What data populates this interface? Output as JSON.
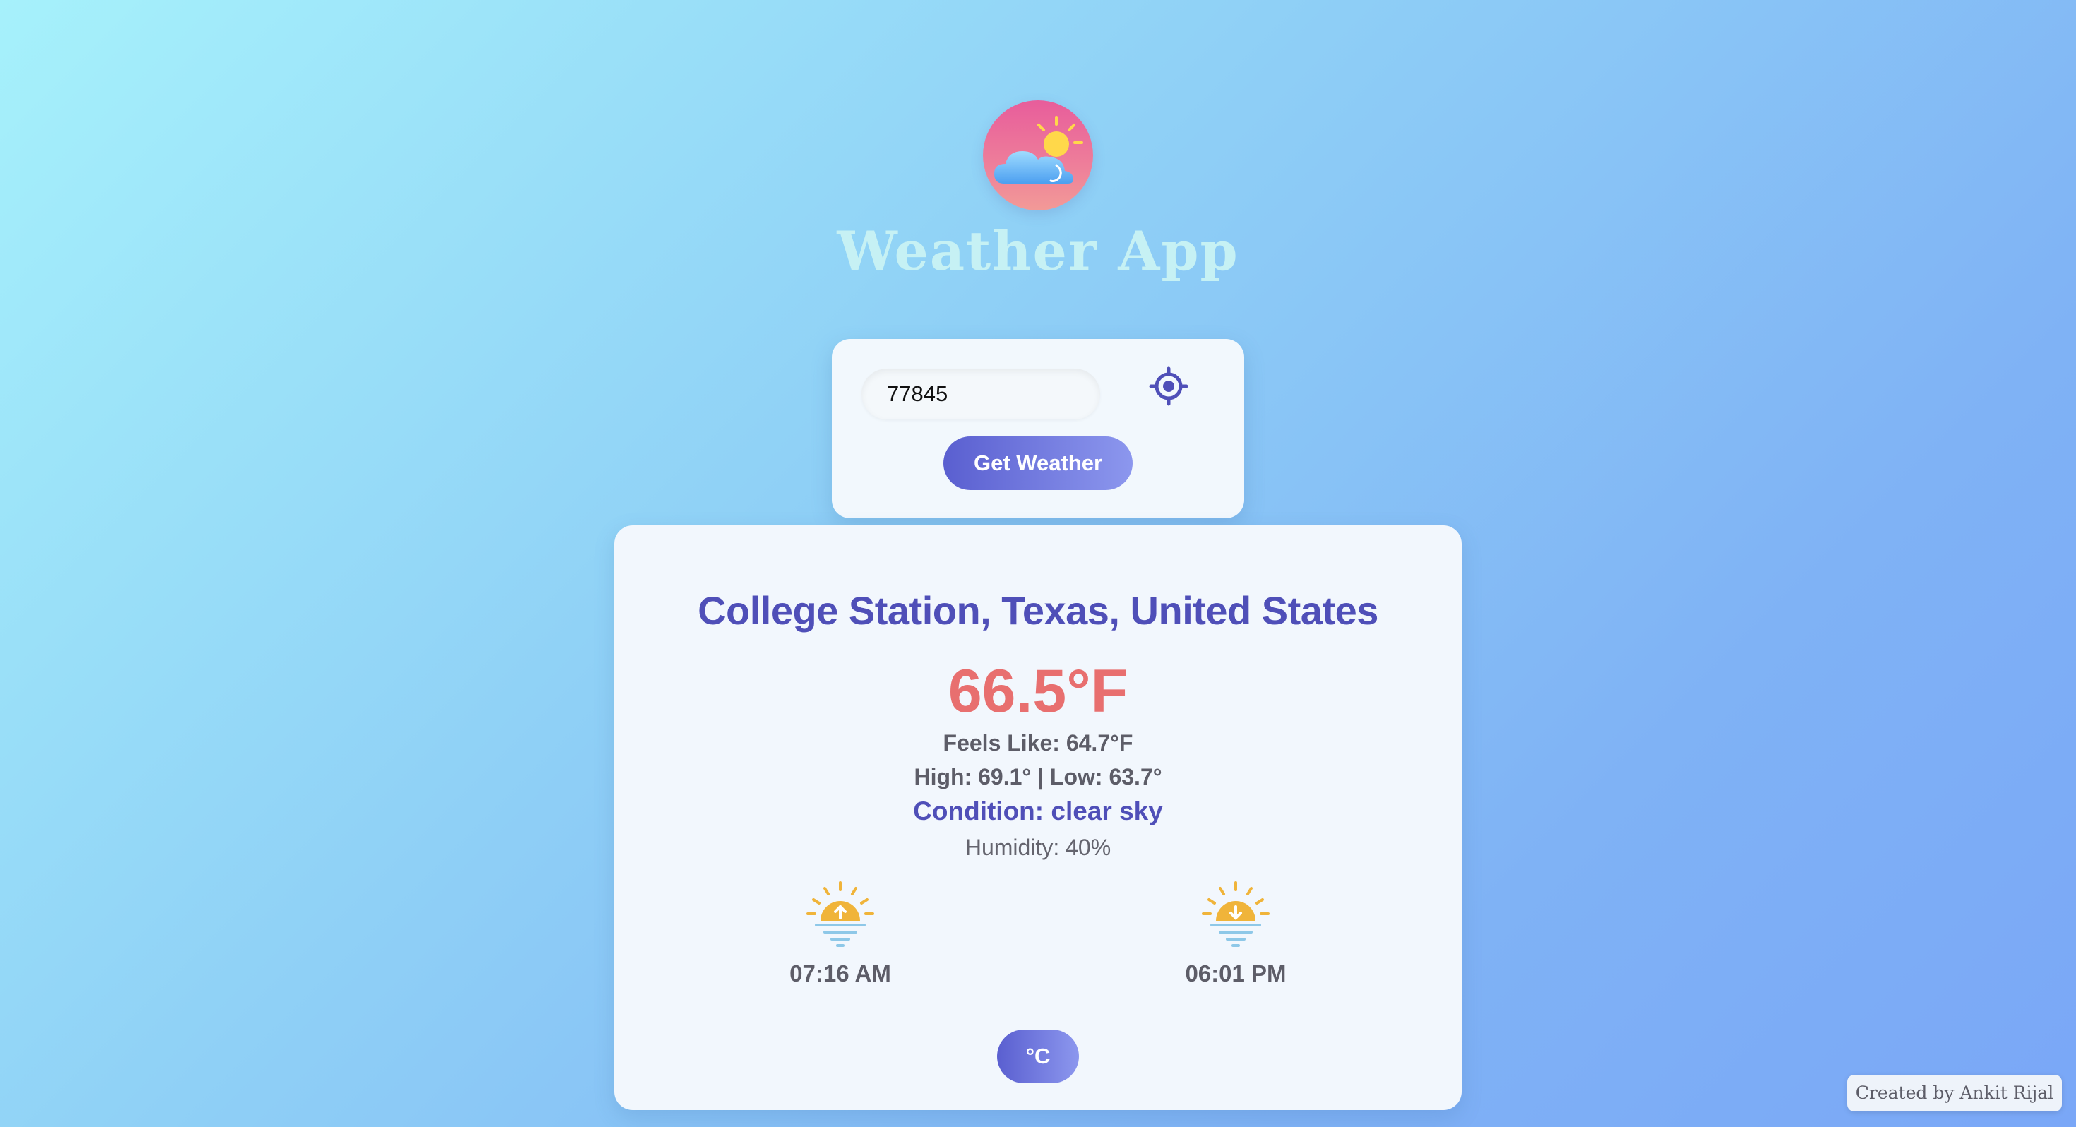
{
  "app": {
    "title": "Weather App",
    "logo_icon": "cloud-sun-icon"
  },
  "search": {
    "value": "77845",
    "locate_icon": "crosshair-location-icon",
    "submit_label": "Get Weather"
  },
  "weather": {
    "location": "College Station, Texas, United States",
    "temperature": "66.5°F",
    "feels_like": "Feels Like: 64.7°F",
    "high_low": "High: 69.1° | Low: 63.7°",
    "condition": "Condition: clear sky",
    "humidity": "Humidity: 40%",
    "sunrise": {
      "time": "07:16 AM",
      "icon": "sunrise-icon"
    },
    "sunset": {
      "time": "06:01 PM",
      "icon": "sunset-icon"
    },
    "unit_toggle_label": "°C"
  },
  "footer": {
    "credit": "Created by Ankit Rijal"
  },
  "colors": {
    "accent": "#5a5fd0",
    "location_text": "#4f4fb8",
    "temperature_text": "#e86f6f",
    "sun": "#f0b43a",
    "water_lines": "#8ec8e8"
  }
}
